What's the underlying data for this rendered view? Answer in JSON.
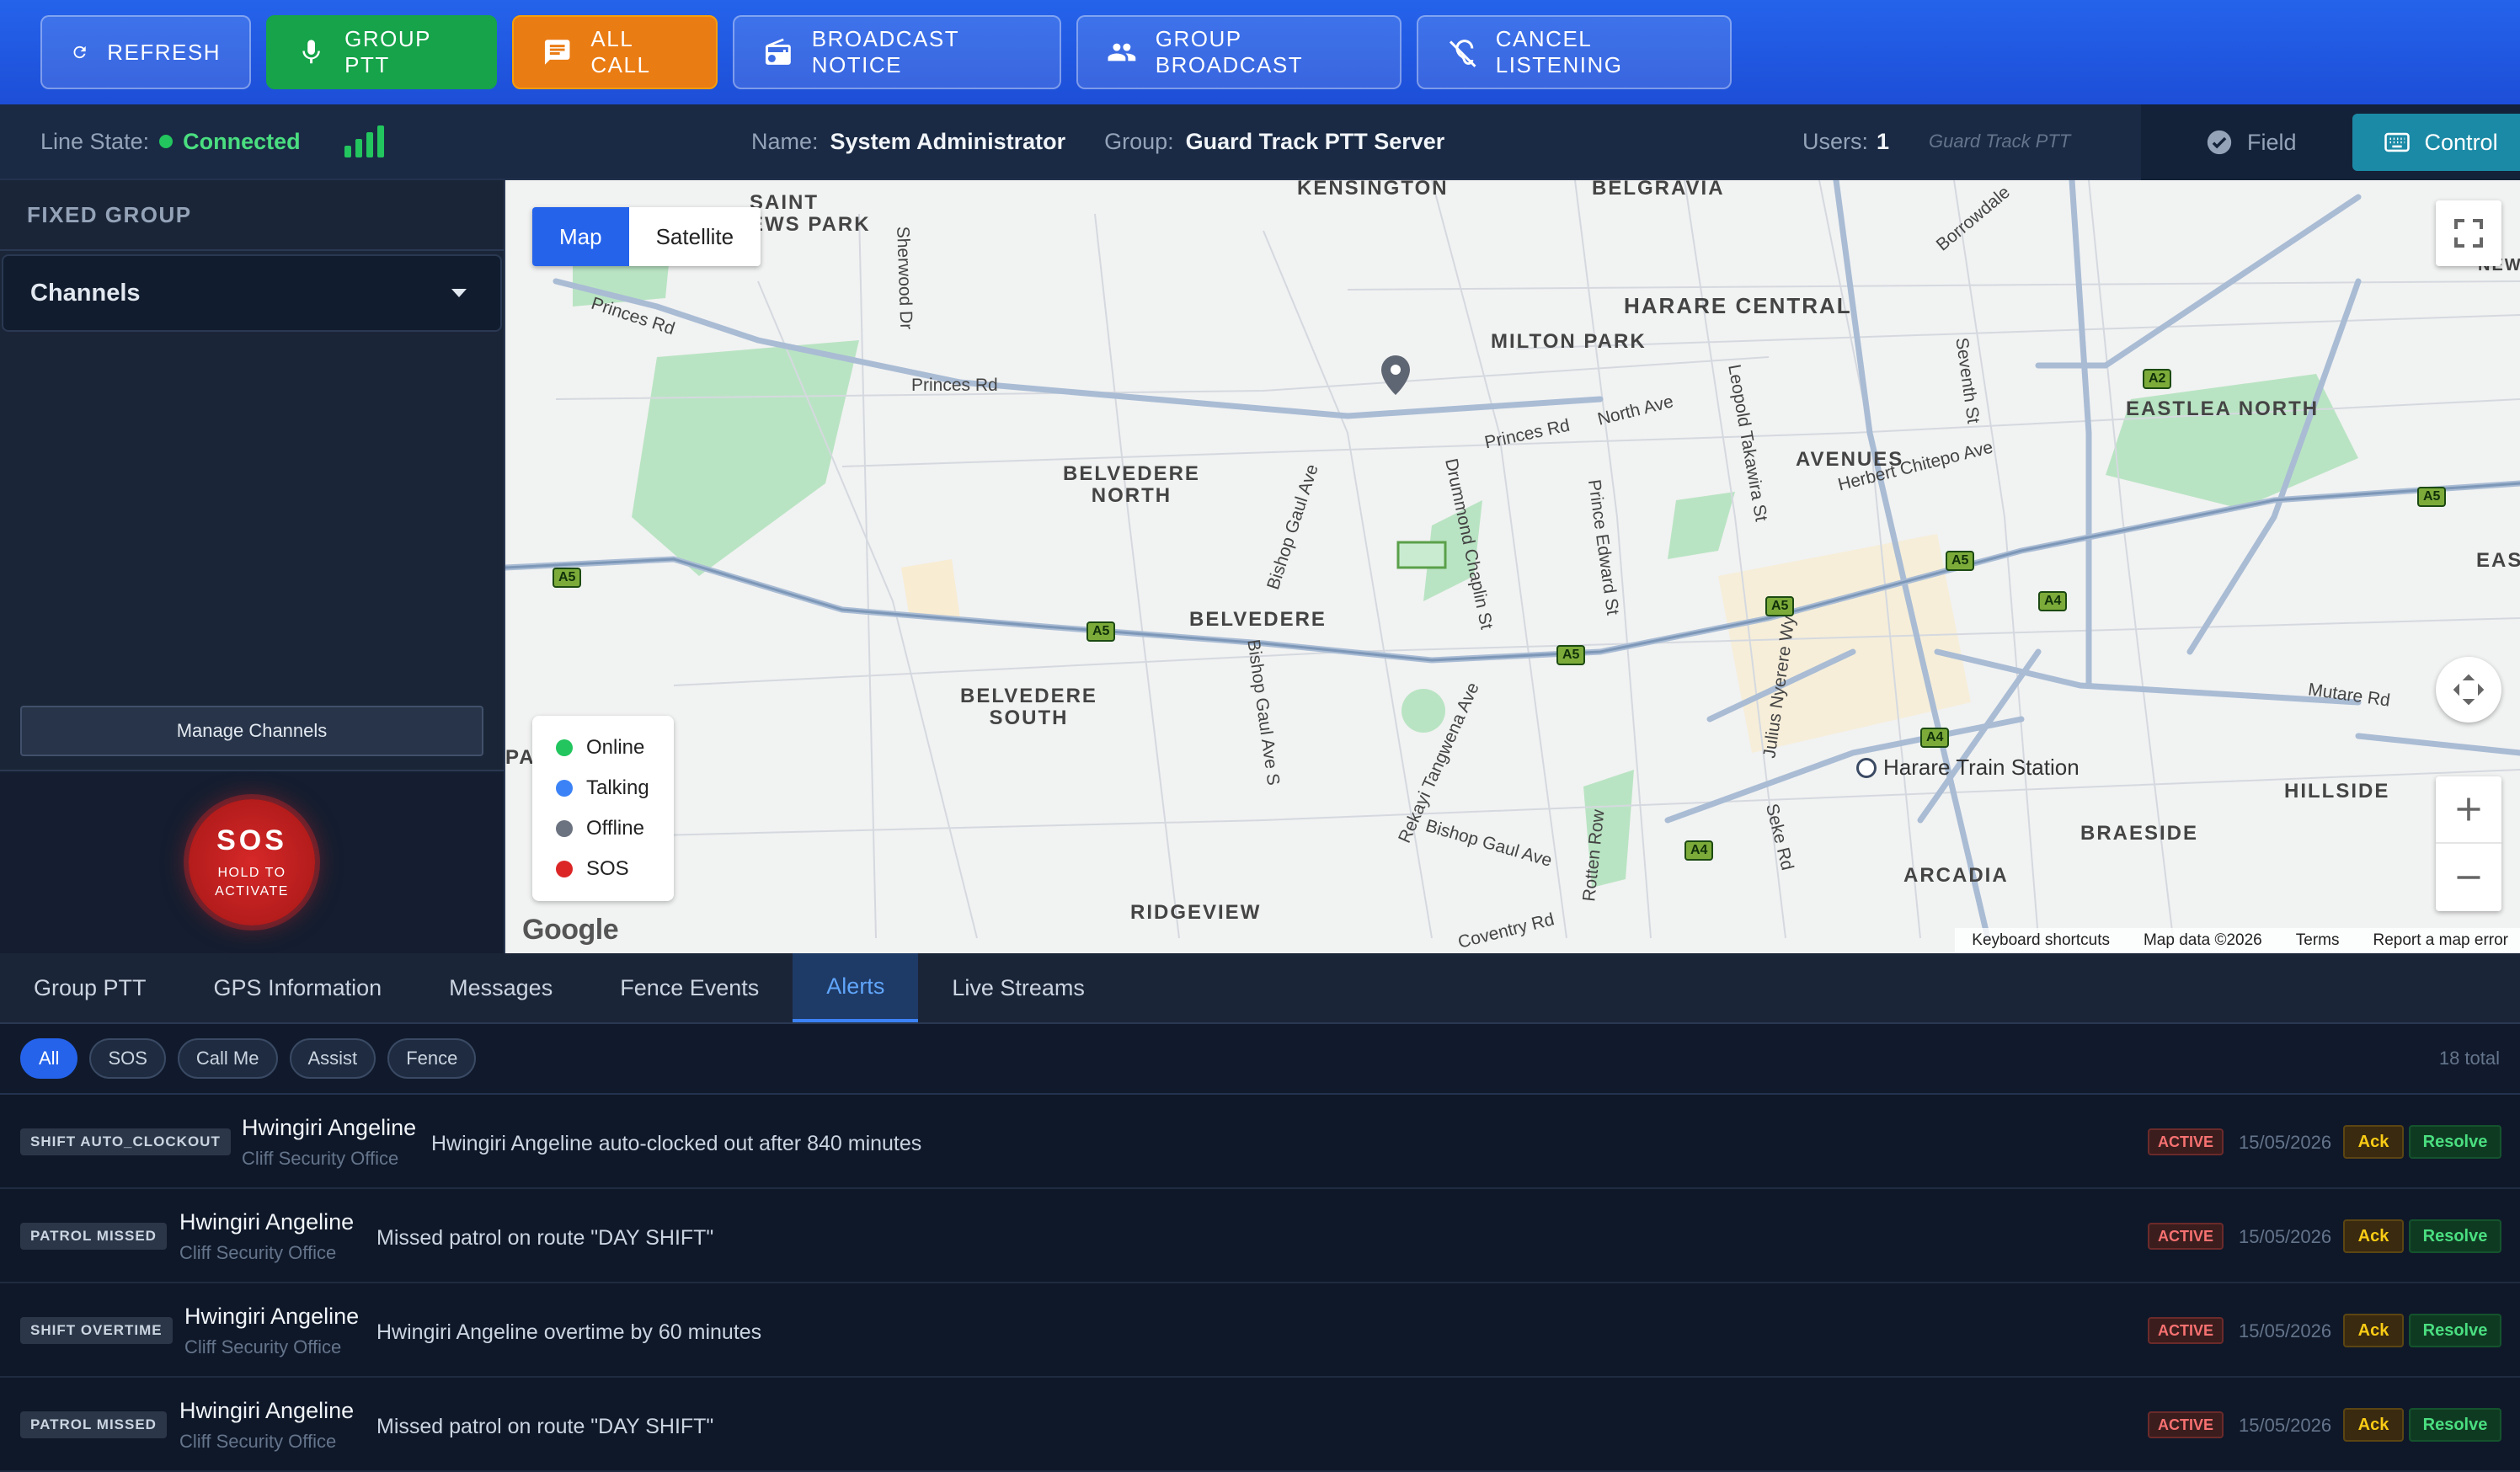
{
  "toolbar": {
    "refresh": "REFRESH",
    "group_ptt": "GROUP PTT",
    "all_call": "ALL CALL",
    "broadcast_notice": "BROADCAST NOTICE",
    "group_broadcast": "GROUP BROADCAST",
    "cancel_listening": "CANCEL LISTENING"
  },
  "status": {
    "line_state_label": "Line State:",
    "line_state_value": "Connected",
    "name_label": "Name:",
    "name_value": "System Administrator",
    "group_label": "Group:",
    "group_value": "Guard Track PTT Server",
    "users_label": "Users:",
    "users_value": "1",
    "brand": "Guard Track PTT",
    "mode_field": "Field",
    "mode_control": "Control"
  },
  "sidebar": {
    "title": "FIXED GROUP",
    "channels_label": "Channels",
    "manage_channels": "Manage Channels",
    "sos_title": "SOS",
    "sos_sub": "HOLD TO ACTIVATE"
  },
  "map": {
    "type_map": "Map",
    "type_satellite": "Satellite",
    "legend": [
      {
        "label": "Online",
        "color": "#22c55e"
      },
      {
        "label": "Talking",
        "color": "#3b82f6"
      },
      {
        "label": "Offline",
        "color": "#6b7280"
      },
      {
        "label": "SOS",
        "color": "#dc2626"
      }
    ],
    "attribution": {
      "shortcuts": "Keyboard shortcuts",
      "data": "Map data ©2026",
      "terms": "Terms",
      "report": "Report a map error"
    },
    "google": "Google",
    "areas": {
      "saint_news": "SAINT\nEWS PARK",
      "kensington": "KENSINGTON",
      "belgravia": "BELGRAVIA",
      "harare_central": "HARARE CENTRAL",
      "milton_park": "MILTON PARK",
      "eastlea_north": "EASTLEA NORTH",
      "avenues": "AVENUES",
      "belvedere_north": "BELVEDERE\nNORTH",
      "belvedere": "BELVEDERE",
      "belvedere_south": "BELVEDERE\nSOUTH",
      "hillside": "HILLSIDE",
      "braeside": "BRAESIDE",
      "arcadia": "ARCADIA",
      "ridgeview": "RIDGEVIEW",
      "east": "EAST",
      "newla": "NEWLA",
      "pa": "PA"
    },
    "roads": {
      "princes_rd_1": "Princes Rd",
      "princes_rd_2": "Princes Rd",
      "princes_rd_3": "Princes Rd",
      "north_ave": "North Ave",
      "herbert_chitepo": "Herbert Chitepo Ave",
      "mutare_rd": "Mutare Rd",
      "sherwood_dr": "Sherwood Dr",
      "bishop_gaul_ave": "Bishop Gaul Ave",
      "drummond_chaplin": "Drummond Chaplin St",
      "prince_edward": "Prince Edward St",
      "leopold_takawira": "Leopold Takawira St",
      "seventh_st": "Seventh St",
      "julius_nyerere": "Julius Nyerere Wy",
      "seke_rd": "Seke Rd",
      "rotten_row": "Rotten Row",
      "rekayi": "Rekayi Tangwena Ave",
      "bishop_gaul_s": "Bishop Gaul Ave S",
      "bishop_gaul_2": "Bishop Gaul Ave",
      "coventry": "Coventry Rd",
      "borrowdale": "Borrowdale"
    },
    "shields": [
      "A5",
      "A5",
      "A5",
      "A5",
      "A5",
      "A5",
      "A4",
      "A4",
      "A4",
      "A2"
    ],
    "station": "Harare Train Station"
  },
  "tabs": [
    "Group PTT",
    "GPS Information",
    "Messages",
    "Fence Events",
    "Alerts",
    "Live Streams"
  ],
  "filters": {
    "chips": [
      "All",
      "SOS",
      "Call Me",
      "Assist",
      "Fence"
    ],
    "total": "18 total"
  },
  "alerts": [
    {
      "type": "SHIFT AUTO_CLOCKOUT",
      "name": "Hwingiri Angeline",
      "office": "Cliff Security Office",
      "message": "Hwingiri Angeline auto-clocked out after 840 minutes",
      "status": "ACTIVE",
      "date": "15/05/2026",
      "ack": "Ack",
      "resolve": "Resolve"
    },
    {
      "type": "PATROL MISSED",
      "name": "Hwingiri Angeline",
      "office": "Cliff Security Office",
      "message": "Missed patrol on route \"DAY SHIFT\"",
      "status": "ACTIVE",
      "date": "15/05/2026",
      "ack": "Ack",
      "resolve": "Resolve"
    },
    {
      "type": "SHIFT OVERTIME",
      "name": "Hwingiri Angeline",
      "office": "Cliff Security Office",
      "message": "Hwingiri Angeline overtime by 60 minutes",
      "status": "ACTIVE",
      "date": "15/05/2026",
      "ack": "Ack",
      "resolve": "Resolve"
    },
    {
      "type": "PATROL MISSED",
      "name": "Hwingiri Angeline",
      "office": "Cliff Security Office",
      "message": "Missed patrol on route \"DAY SHIFT\"",
      "status": "ACTIVE",
      "date": "15/05/2026",
      "ack": "Ack",
      "resolve": "Resolve"
    }
  ]
}
